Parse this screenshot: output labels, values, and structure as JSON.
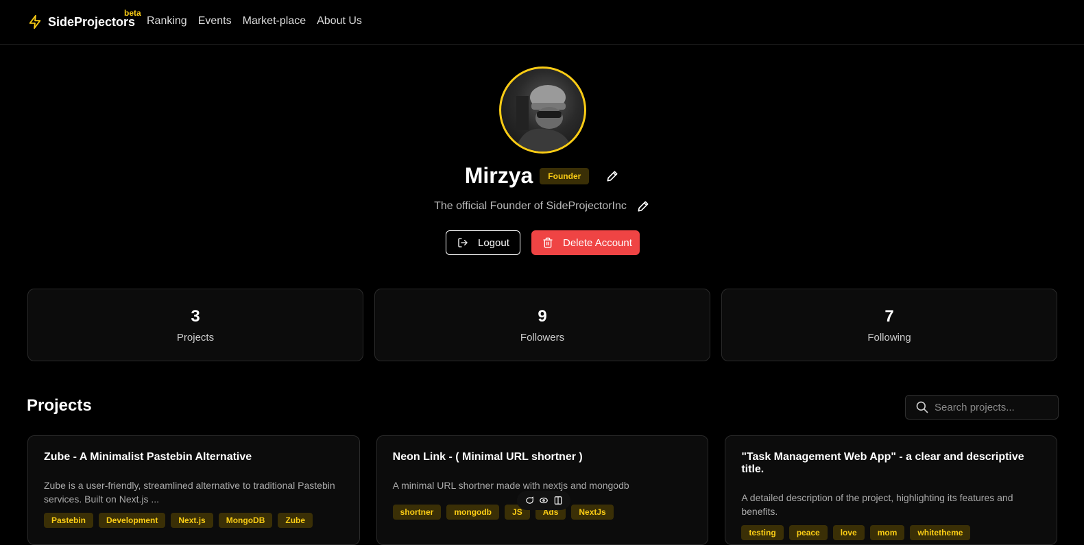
{
  "nav": {
    "brand": "SideProjectors",
    "beta": "beta",
    "links": [
      "Ranking",
      "Events",
      "Market-place",
      "About Us"
    ]
  },
  "profile": {
    "name": "Mirzya",
    "role_badge": "Founder",
    "bio": "The official Founder of SideProjectorInc",
    "logout_label": "Logout",
    "delete_label": "Delete Account"
  },
  "stats": [
    {
      "value": "3",
      "label": "Projects"
    },
    {
      "value": "9",
      "label": "Followers"
    },
    {
      "value": "7",
      "label": "Following"
    }
  ],
  "projects": {
    "title": "Projects",
    "search_placeholder": "Search projects...",
    "items": [
      {
        "title": "Zube - A Minimalist Pastebin Alternative",
        "description": "Zube is a user-friendly, streamlined alternative to traditional Pastebin services. Built on Next.js ...",
        "tags": [
          "Pastebin",
          "Development",
          "Next.js",
          "MongoDB",
          "Zube"
        ]
      },
      {
        "title": "Neon Link - ( Minimal URL shortner )",
        "description": "A minimal URL shortner made with nextjs and mongodb",
        "tags": [
          "shortner",
          "mongodb",
          "JS",
          "Ads",
          "NextJs"
        ]
      },
      {
        "title": "\"Task Management Web App\" - a clear and descriptive title.",
        "description": "A detailed description of the project, highlighting its features and benefits.",
        "tags": [
          "testing",
          "peace",
          "love",
          "mom",
          "whitetheme"
        ]
      }
    ]
  },
  "colors": {
    "accent": "#facc15",
    "danger": "#ef4444",
    "background": "#000000"
  },
  "icons": [
    "lightning-icon",
    "pencil-icon",
    "logout-icon",
    "trash-icon",
    "search-icon",
    "chat-icon",
    "eye-icon",
    "book-icon"
  ]
}
